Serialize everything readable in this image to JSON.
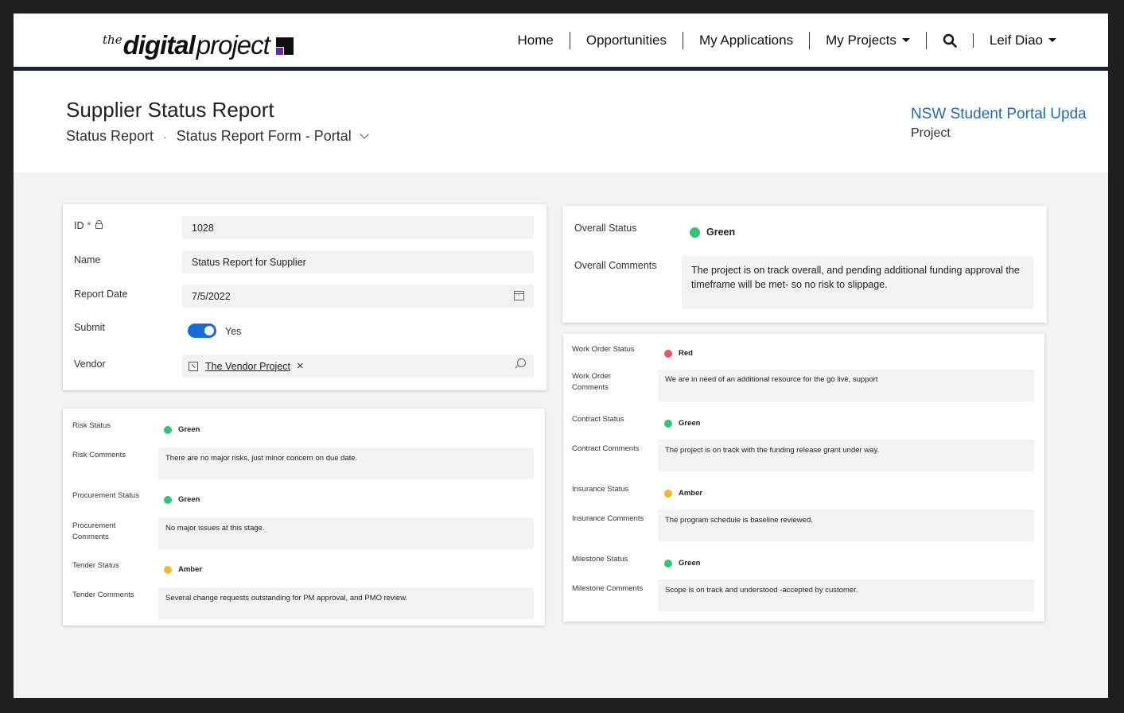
{
  "nav": {
    "logo": {
      "the": "the",
      "digital": "digital",
      "project": "project"
    },
    "items": [
      {
        "label": "Home"
      },
      {
        "label": "Opportunities"
      },
      {
        "label": "My Applications"
      },
      {
        "label": "My Projects",
        "has_caret": true
      },
      {
        "label": "",
        "icon": "search-icon"
      },
      {
        "label": "Leif Diao",
        "has_caret": true
      }
    ]
  },
  "header": {
    "title": "Supplier Status Report",
    "breadcrumb": {
      "entity": "Status Report",
      "separator": "·",
      "form": "Status Report Form - Portal"
    },
    "project_link": "NSW Student Portal Upda",
    "project_type": "Project"
  },
  "general": {
    "id_label": "ID",
    "id_required": "*",
    "id_value": "1028",
    "name_label": "Name",
    "name_value": "Status Report for Supplier",
    "date_label": "Report Date",
    "date_value": "7/5/2022",
    "submit_label": "Submit",
    "submit_value": "Yes",
    "vendor_label": "Vendor",
    "vendor_value": "The Vendor Project",
    "vendor_clear": "×"
  },
  "overall": {
    "status_label": "Overall Status",
    "status_value": "Green",
    "comments_label": "Overall Comments",
    "comments_value": "The project is on track overall, and pending additional funding approval the timeframe will be met- so no risk to slippage."
  },
  "left_section": {
    "risk_status_label": "Risk Status",
    "risk_status_value": "Green",
    "risk_comments_label": "Risk Comments",
    "risk_comments_value": "There are no major risks, just minor concern on due date.",
    "procurement_status_label": "Procurement Status",
    "procurement_status_value": "Green",
    "procurement_comments_label_1": "Procurement",
    "procurement_comments_label_2": "Comments",
    "procurement_comments_value": "No major issues at this stage.",
    "tender_status_label": "Tender Status",
    "tender_status_value": "Amber",
    "tender_comments_label": "Tender Comments",
    "tender_comments_value": "Several change requests outstanding for PM approval, and PMO review."
  },
  "right_section": {
    "work_order_status_label": "Work Order Status",
    "work_order_status_value": "Red",
    "work_order_comments_label_1": "Work Order",
    "work_order_comments_label_2": "Comments",
    "work_order_comments_value": "We are in need of an additional resource for the go live, support",
    "contract_status_label": "Contract Status",
    "contract_status_value": "Green",
    "contract_comments_label": "Contract Comments",
    "contract_comments_value": "The project is on track with the funding release grant under way.",
    "insurance_status_label": "Insurance Status",
    "insurance_status_value": "Amber",
    "insurance_comments_label": "Insurance Comments",
    "insurance_comments_value": "The program schedule is baseline reviewed.",
    "milestone_status_label": "Milestone Status",
    "milestone_status_value": "Green",
    "milestone_comments_label": "Milestone Comments",
    "milestone_comments_value": "Scope is on track and understood -accepted by customer."
  },
  "colors": {
    "green": "#35c27a",
    "amber": "#f5b52c",
    "red": "#e9566b",
    "accent": "#1769d3",
    "link": "#1e6cb3",
    "nav_border": "#1b2330"
  }
}
